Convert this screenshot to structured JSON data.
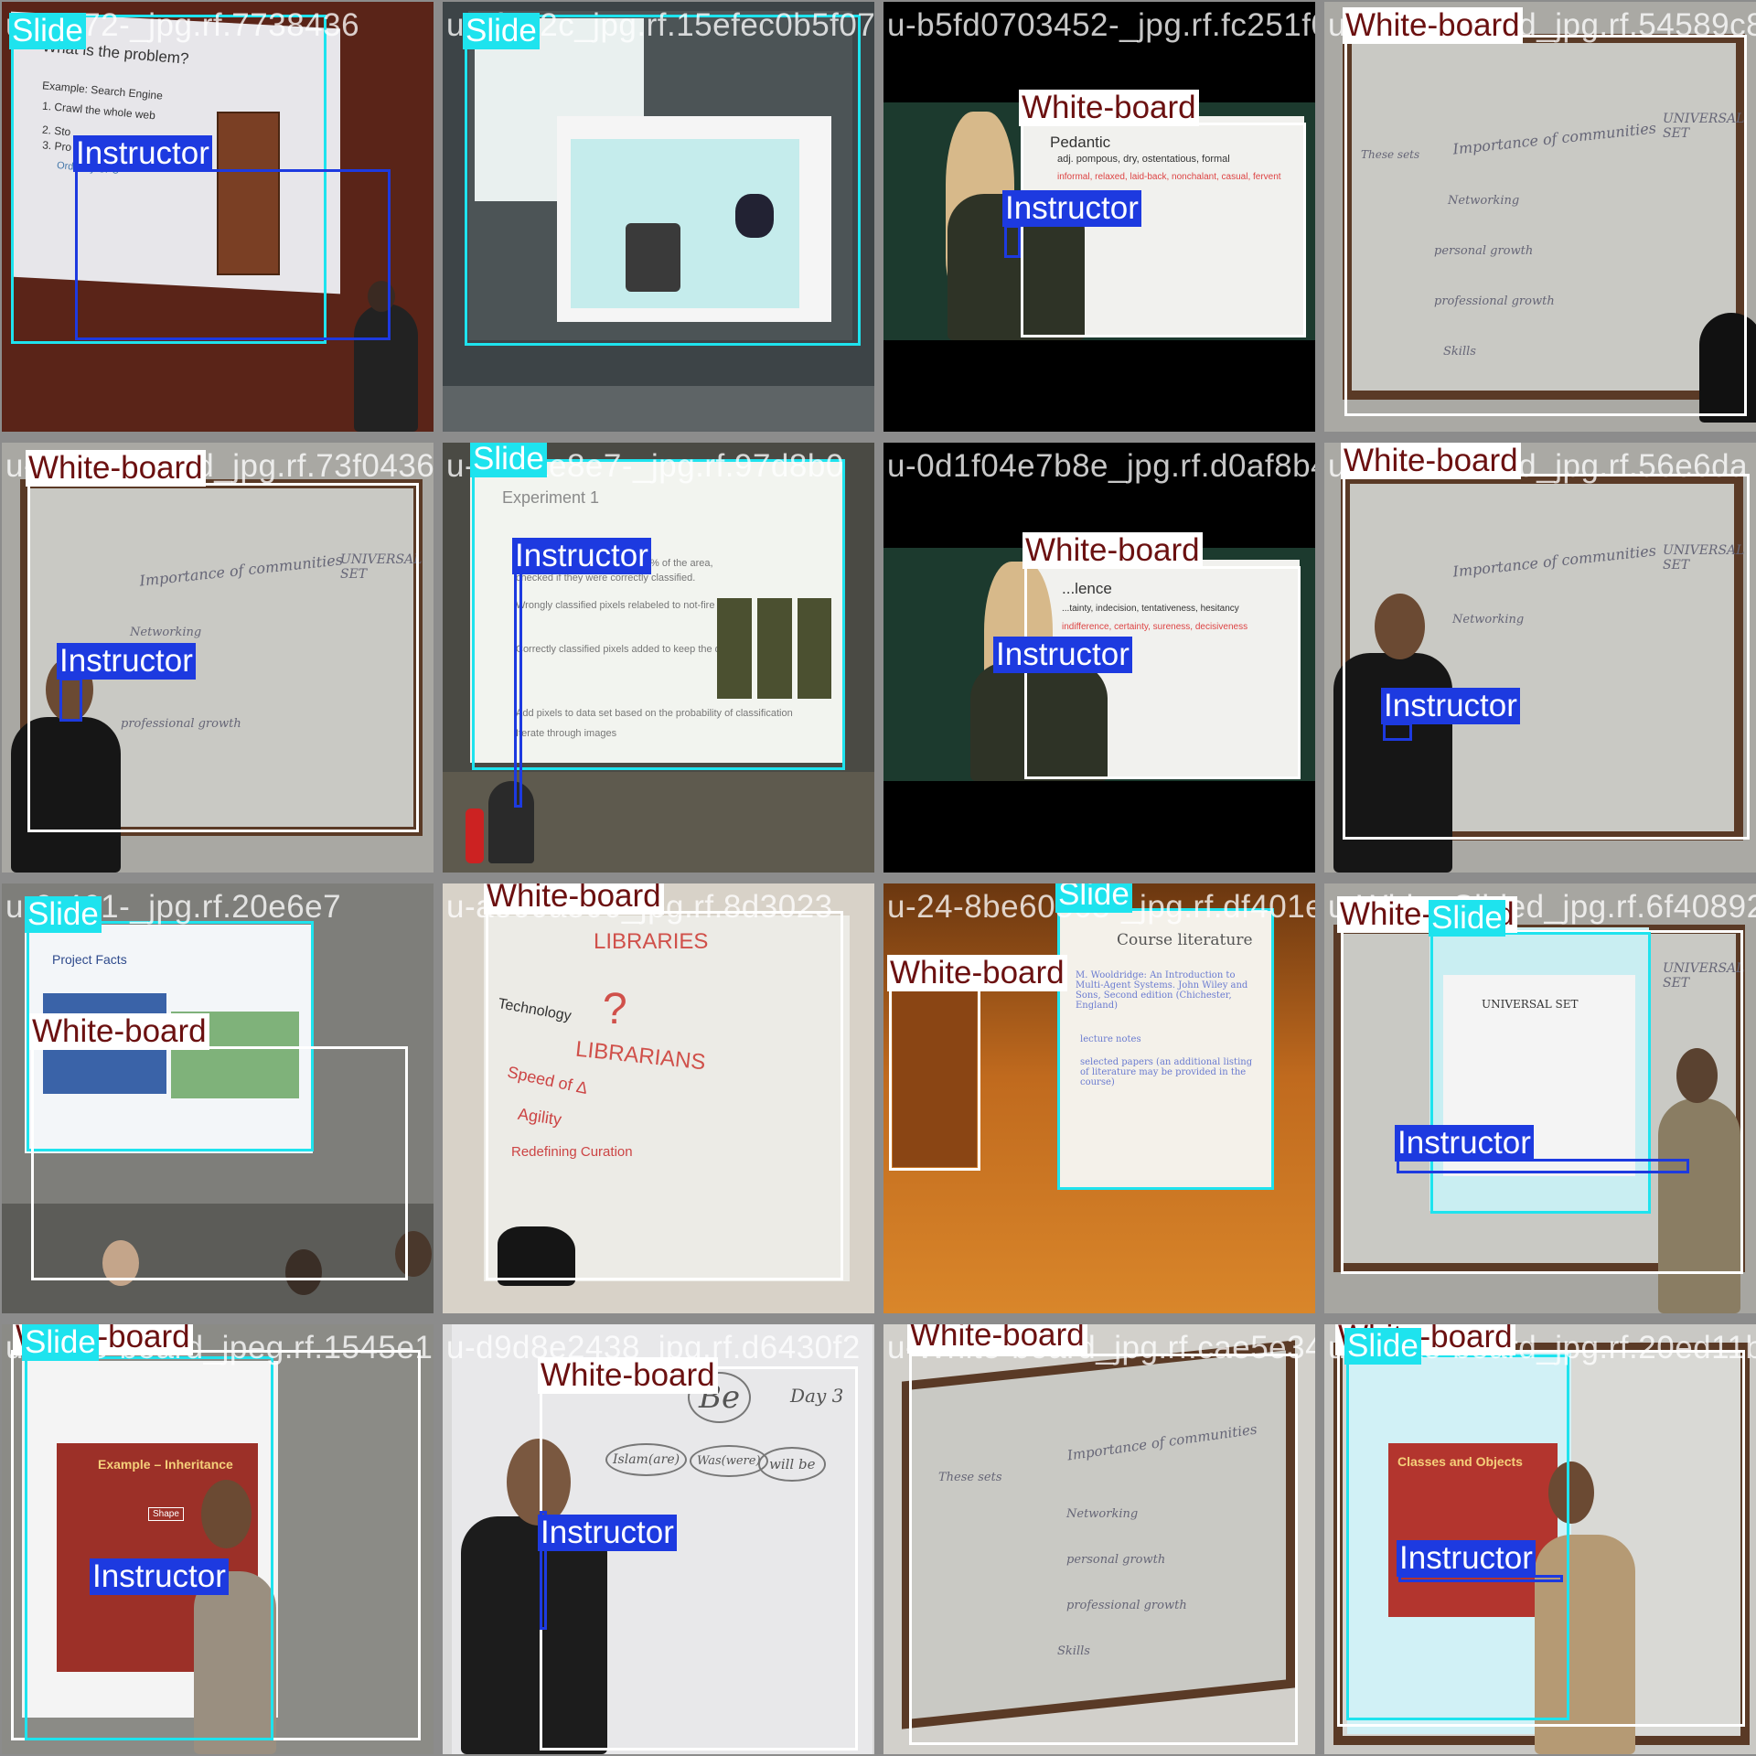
{
  "tiles": [
    {
      "filename": "u-0-472-_jpg.rf.7738436",
      "labels": [
        "Slide",
        "Instructor"
      ]
    },
    {
      "filename": "u-0f192c_jpg.rf.15efec0b5f0703452",
      "labels": [
        "Slide"
      ]
    },
    {
      "filename": "u-b5fd0703452-_jpg.rf.fc251f07",
      "labels": [
        "White-board",
        "Instructor"
      ]
    },
    {
      "filename": "u-White-board_jpg.rf.54589c8",
      "labels": [
        "White-board"
      ]
    },
    {
      "filename": "u-White-board_jpg.rf.73f0436",
      "labels": [
        "White-board",
        "Instructor"
      ]
    },
    {
      "filename": "u-8d2ae8e7-_jpg.rf.97d8b0",
      "labels": [
        "Slide",
        "Instructor"
      ]
    },
    {
      "filename": "u-0d1f04e7b8e_jpg.rf.d0af8b4",
      "labels": [
        "White-board",
        "Instructor"
      ]
    },
    {
      "filename": "u-White-board_jpg.rf.56e6da",
      "labels": [
        "White-board",
        "Instructor"
      ]
    },
    {
      "filename": "u-0-461-_jpg.rf.20e6e7",
      "labels": [
        "Slide",
        "White-board"
      ]
    },
    {
      "filename": "u-ae60a506_jpg.rf.8d3023",
      "labels": [
        "White-board"
      ]
    },
    {
      "filename": "u-24-8be60563-_jpg.rf.df401ee",
      "labels": [
        "Slide",
        "White-board"
      ]
    },
    {
      "filename": "u-White-Slided_jpg.rf.6f40892",
      "labels": [
        "White-board",
        "Slide",
        "Instructor"
      ]
    },
    {
      "filename": "u-Slide-board_jpeg.rf.1545e1",
      "labels": [
        "White-board",
        "Slide",
        "Instructor"
      ]
    },
    {
      "filename": "u-d9d8e2438_jpg.rf.d6430f2",
      "labels": [
        "White-board",
        "Instructor"
      ]
    },
    {
      "filename": "u-White-board_jpg.rf.cae5e34",
      "labels": [
        "White-board"
      ]
    },
    {
      "filename": "u-White-board_jpg.rf.20ed11b",
      "labels": [
        "White-board",
        "Slide",
        "Instructor"
      ]
    }
  ],
  "scene_text": {
    "t0": [
      "What is the problem?",
      "Example: Search Engine",
      "1. Crawl the whole web",
      "2. Sto",
      "3. Pro  ss search requests on",
      "Ordinary CPU"
    ],
    "t2": [
      "Pedantic",
      "adj. pompous, dry, ostentatious, formal",
      "informal, relaxed, laid-back, nonchalant, casual, fervent"
    ],
    "t3": [
      "Importance of communities",
      "UNIVERSAL SET",
      "These sets",
      "Networking",
      "personal growth",
      "professional growth",
      "Skills"
    ],
    "t5": [
      "Experiment 1",
      "fire more than 3% of the area,",
      "checked if they were correctly classified.",
      "Wrongly classified pixels relabeled to not-fire",
      "Correctly classified pixels added to keep the dataset",
      "Add pixels to data set based on the probability of classification",
      "Iterate through images"
    ],
    "t6": [
      "...lence",
      "...tainty, indecision, tentativeness, hesitancy",
      "indifference, certainty, sureness, decisiveness"
    ],
    "t8": [
      "Project Facts"
    ],
    "t9": [
      "LIBRARIES",
      "LIBRARIANS",
      "Technology",
      "Speed of Δ",
      "Agility",
      "Redefining Curation"
    ],
    "t10": [
      "Course literature",
      "M. Wooldridge: An Introduction to Multi-Agent Systems. John Wiley and Sons, Second edition (Chichester, England)",
      "lecture notes",
      "selected papers (an additional listing of literature may be provided in the course)"
    ],
    "t11": [
      "UNIVERSAL SET"
    ],
    "t12": [
      "Example – Inheritance",
      "Shape"
    ],
    "t13": [
      "Be",
      "Islam(are)",
      "Was(were)",
      "will be",
      "Day 3"
    ],
    "t15": [
      "Classes and Objects"
    ]
  },
  "colors": {
    "slide": "#1ee3ee",
    "white_board": "#ffffff",
    "instructor": "#1d3ae0"
  }
}
